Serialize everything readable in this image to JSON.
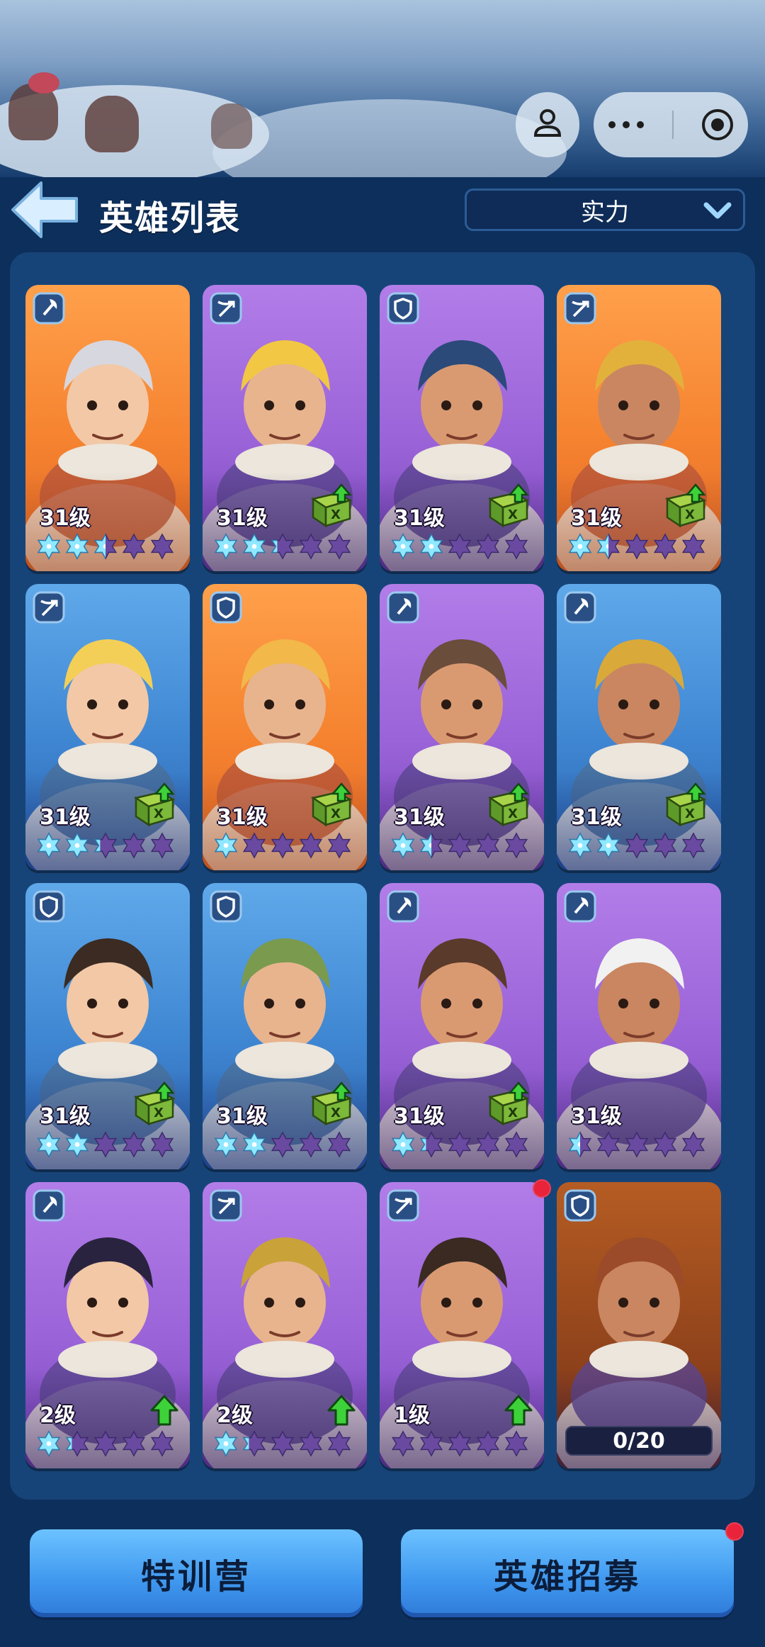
{
  "header": {
    "title": "英雄列表",
    "sort_value": "实力"
  },
  "heroes": [
    {
      "level": "31级",
      "color": "orange",
      "class": "axe",
      "stars": [
        1,
        1,
        0.5,
        0,
        0
      ],
      "upgrade": "none"
    },
    {
      "level": "31级",
      "color": "purple",
      "class": "crossbow",
      "stars": [
        1,
        1,
        0.3,
        0,
        0
      ],
      "upgrade": "book"
    },
    {
      "level": "31级",
      "color": "purple",
      "class": "shield",
      "stars": [
        1,
        1,
        0,
        0,
        0
      ],
      "upgrade": "book"
    },
    {
      "level": "31级",
      "color": "orange",
      "class": "crossbow",
      "stars": [
        1,
        0.5,
        0,
        0,
        0
      ],
      "upgrade": "book"
    },
    {
      "level": "31级",
      "color": "blue",
      "class": "crossbow",
      "stars": [
        1,
        1,
        0.3,
        0,
        0
      ],
      "upgrade": "book"
    },
    {
      "level": "31级",
      "color": "orange",
      "class": "shield",
      "stars": [
        1,
        0,
        0,
        0,
        0
      ],
      "upgrade": "book"
    },
    {
      "level": "31级",
      "color": "purple",
      "class": "axe",
      "stars": [
        1,
        0.5,
        0,
        0,
        0
      ],
      "upgrade": "book"
    },
    {
      "level": "31级",
      "color": "blue",
      "class": "axe",
      "stars": [
        1,
        1,
        0,
        0,
        0
      ],
      "upgrade": "book"
    },
    {
      "level": "31级",
      "color": "blue",
      "class": "shield",
      "stars": [
        1,
        1,
        0,
        0,
        0
      ],
      "upgrade": "book"
    },
    {
      "level": "31级",
      "color": "blue",
      "class": "shield",
      "stars": [
        1,
        1,
        0,
        0,
        0
      ],
      "upgrade": "book"
    },
    {
      "level": "31级",
      "color": "purple",
      "class": "axe",
      "stars": [
        1,
        0.3,
        0,
        0,
        0
      ],
      "upgrade": "book"
    },
    {
      "level": "31级",
      "color": "purple",
      "class": "axe",
      "stars": [
        0.5,
        0,
        0,
        0,
        0
      ],
      "upgrade": "none"
    },
    {
      "level": "2级",
      "color": "purple",
      "class": "axe",
      "stars": [
        1,
        0.3,
        0,
        0,
        0
      ],
      "upgrade": "arrow"
    },
    {
      "level": "2级",
      "color": "purple",
      "class": "crossbow",
      "stars": [
        1,
        0.3,
        0,
        0,
        0
      ],
      "upgrade": "arrow"
    },
    {
      "level": "1级",
      "color": "purple",
      "class": "crossbow",
      "stars": [
        0,
        0,
        0,
        0,
        0
      ],
      "upgrade": "arrow",
      "red_dot": true
    },
    {
      "level": "",
      "color": "locked",
      "class": "shield",
      "stars": [],
      "upgrade": "none",
      "fragments": "0/20"
    }
  ],
  "buttons": {
    "train": "特训营",
    "recruit": "英雄招募"
  },
  "colors": {
    "star_on": "#8fe8ff",
    "star_off": "#6a4aa0",
    "panel": "#174478",
    "bg": "#0d2f5c",
    "accent_green": "#3ed23a"
  },
  "icons": {
    "back": "back-arrow-icon",
    "mini": "game-controller-icon",
    "more": "more-icon",
    "close": "target-circle-icon",
    "chevron": "chevron-down-icon"
  }
}
